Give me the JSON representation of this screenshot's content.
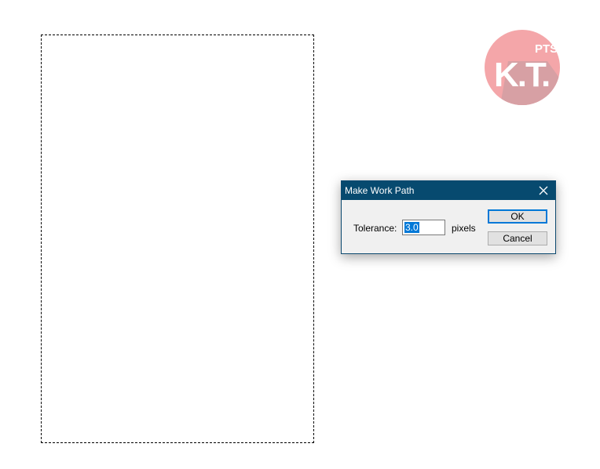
{
  "logo": {
    "small_text": "PTS",
    "big_text": "K.T.",
    "circle_color": "#f4a6a9",
    "shadow_color": "#d7a0a4"
  },
  "dialog": {
    "title": "Make Work Path",
    "close_icon": "close-icon",
    "tolerance_label": "Tolerance:",
    "tolerance_value": "3.0",
    "units_label": "pixels",
    "ok_label": "OK",
    "cancel_label": "Cancel",
    "titlebar_color": "#074a6f",
    "accent_color": "#0078d7"
  }
}
